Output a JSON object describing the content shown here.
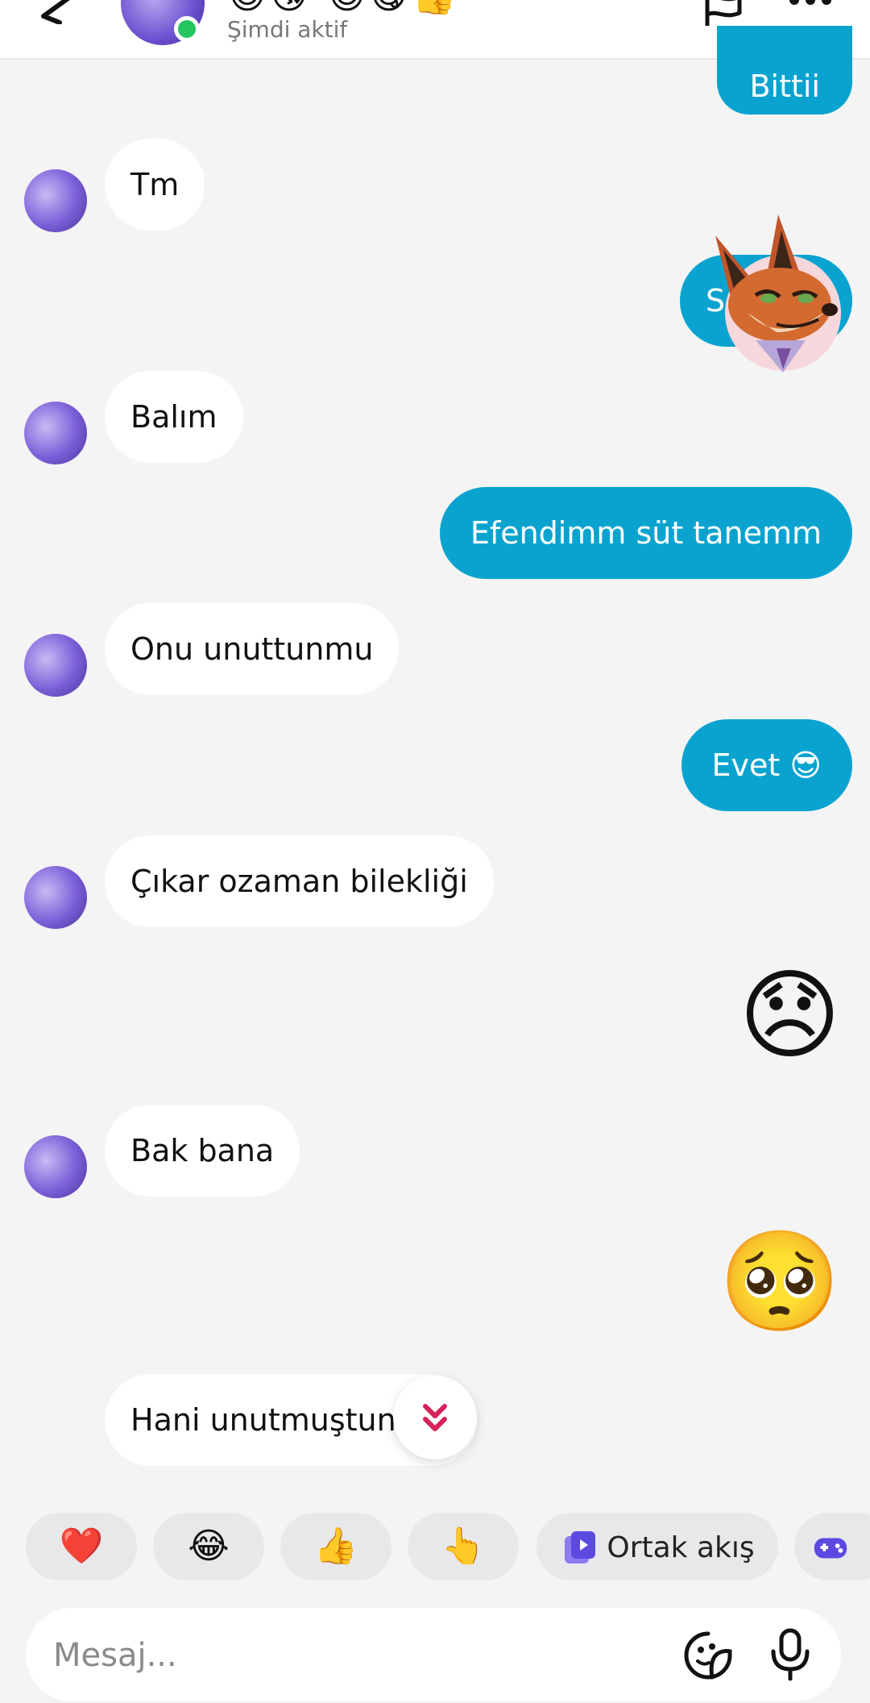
{
  "header": {
    "title_emoji": "😊😘 😎😋👍",
    "status": "Şimdi aktif"
  },
  "messages": [
    {
      "direction": "out",
      "text": "Bittii"
    },
    {
      "direction": "in",
      "text": "Tm"
    },
    {
      "direction": "out",
      "text": "Sıra"
    },
    {
      "direction": "in",
      "text": "Balım"
    },
    {
      "direction": "out",
      "text": "Efendimm süt tanemm"
    },
    {
      "direction": "in",
      "text": "Onu unuttunmu"
    },
    {
      "direction": "out",
      "text": "Evet 😎"
    },
    {
      "direction": "in",
      "text": "Çıkar ozaman bilekliği"
    },
    {
      "direction": "out",
      "text": "😞"
    },
    {
      "direction": "in",
      "text": "Bak bana"
    },
    {
      "direction": "out",
      "text": "🥺"
    },
    {
      "direction": "in",
      "text": "Hani unutmuştun"
    }
  ],
  "quick_reactions": [
    {
      "emoji": "❤️"
    },
    {
      "emoji": "😂"
    },
    {
      "emoji": "👍"
    },
    {
      "emoji": "👆"
    },
    {
      "label": "Ortak akış",
      "icon": "shared-feed-icon"
    },
    {
      "icon": "game-controller-icon"
    }
  ],
  "composer": {
    "placeholder": "Mesaj..."
  },
  "colors": {
    "outgoing_bubble": "#0aa3cf",
    "background": "#f4f4f5",
    "online": "#22c55e",
    "accent": "#6b5ce7"
  }
}
